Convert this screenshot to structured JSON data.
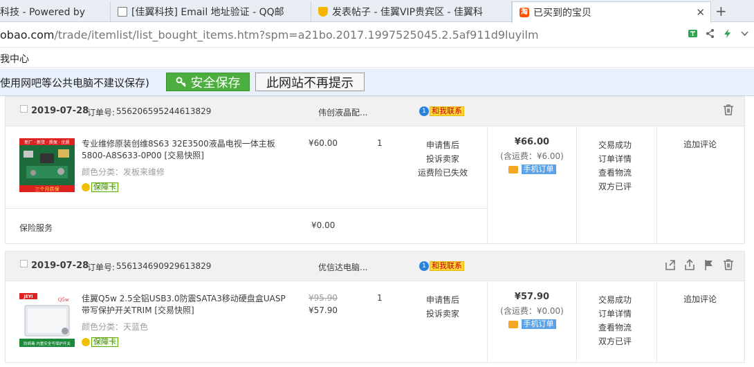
{
  "browser": {
    "tabs": [
      {
        "label": "科技 - Powered by",
        "favicon": "none"
      },
      {
        "label": "[佳翼科技] Email 地址验证 - QQ邮",
        "favicon": "document-icon"
      },
      {
        "label": "发表帖子 - 佳翼VIP贵宾区 - 佳翼科",
        "favicon": "cup-icon"
      },
      {
        "label": "已买到的宝贝",
        "favicon": "taobao-icon",
        "fav_text": "淘",
        "active": true
      }
    ],
    "close_glyph": "✕",
    "new_tab_glyph": "+",
    "url_prefix": "obao.com",
    "url_rest": "/trade/itemlist/list_bought_items.htm?spm=a21bo.2017.1997525045.2.5af911d9luyilm",
    "bookmark": "我中心"
  },
  "password_bar": {
    "text": "使用网吧等公共电脑不建议保存)",
    "save_label": "安全保存",
    "never_label": "此网站不再提示"
  },
  "contact_label": "和我联系",
  "guarantee_label": "保障卡",
  "mobile_order_label": "手机订单",
  "order_num_label": "订单号:",
  "review_label": "追加评论",
  "orders": [
    {
      "date": "2019-07-28",
      "order_number": "556206595244613829",
      "shop": "伟创液晶配...",
      "product_title": "专业维修原装创维8S63 32E3500液晶电视一体主板5800-A8S633-0P00 [交易快照]",
      "color_label": "颜色分类：发板来维修",
      "price_original": "",
      "price": "¥60.00",
      "quantity": "1",
      "service": [
        "申请售后",
        "投诉卖家",
        "运费险已失效"
      ],
      "total": "¥66.00",
      "shipping": "(含运费：¥6.00)",
      "status": [
        "交易成功",
        "订单详情",
        "查看物流",
        "双方已评"
      ],
      "insurance_label": "保险服务",
      "insurance_price": "¥0.00"
    },
    {
      "date": "2019-07-28",
      "order_number": "556134690929613829",
      "shop": "优信达电脑...",
      "product_title": "佳翼Q5w 2.5全铝USB3.0防震SATA3移动硬盘盒UASP带写保护开关TRIM [交易快照]",
      "color_label": "颜色分类：天蓝色",
      "price_original": "¥95.90",
      "price": "¥57.90",
      "quantity": "1",
      "service": [
        "申请售后",
        "投诉卖家"
      ],
      "total": "¥57.90",
      "shipping": "(含运费：¥0.00)",
      "status": [
        "交易成功",
        "订单详情",
        "查看物流",
        "双方已评"
      ]
    }
  ],
  "thumb_text": {
    "o1_top": "新厂 · 新货 · 质保 · 优质",
    "o1_bottom": "三个月质保",
    "o2_brand": "JEYI",
    "o2_model": "Q5w",
    "o2_bottom": "防病毒 内置安全写保护开关"
  },
  "colors": {
    "save_green": "#4cae3e",
    "taobao_orange": "#ff5000",
    "contact_yellow": "#ffd93a",
    "mobile_blue": "#5ba3e8"
  }
}
